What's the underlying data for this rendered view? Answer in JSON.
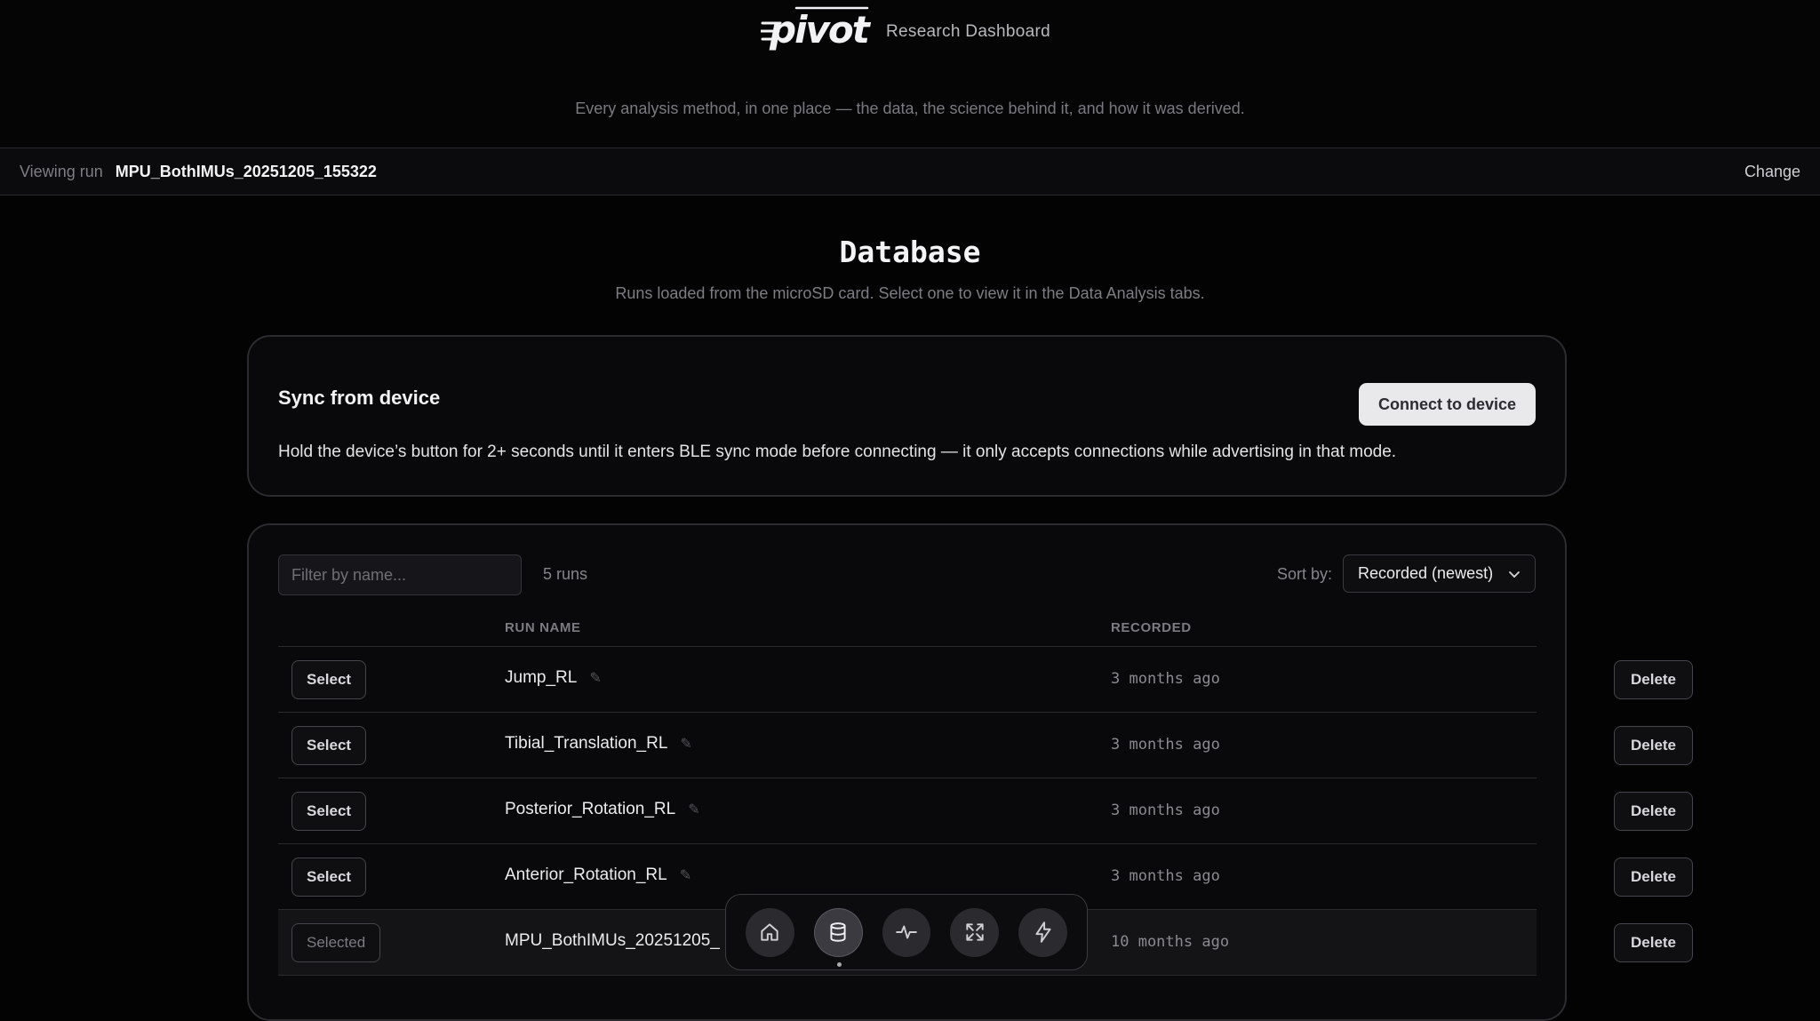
{
  "header": {
    "logo_text": "pivot",
    "subtitle": "Research Dashboard",
    "tagline": "Every analysis method, in one place — the data, the science behind it, and how it was derived."
  },
  "runbar": {
    "label": "Viewing run",
    "run_name": "MPU_BothIMUs_20251205_155322",
    "change_label": "Change"
  },
  "page": {
    "title": "Database",
    "subtitle": "Runs loaded from the microSD card. Select one to view it in the Data Analysis tabs."
  },
  "sync": {
    "title": "Sync from device",
    "hint": "Hold the device’s button for 2+ seconds until it enters BLE sync mode before connecting — it only accepts connections while advertising in that mode.",
    "connect_label": "Connect to device"
  },
  "runs": {
    "filter_placeholder": "Filter by name...",
    "count": "5 runs",
    "sort_label": "Sort by:",
    "sort_value": "Recorded (newest)",
    "columns": {
      "name": "RUN NAME",
      "recorded": "RECORDED"
    },
    "rows": [
      {
        "select": "Select",
        "name": "Jump_RL",
        "recorded": "3 months ago",
        "delete": "Delete"
      },
      {
        "select": "Select",
        "name": "Tibial_Translation_RL",
        "recorded": "3 months ago",
        "delete": "Delete"
      },
      {
        "select": "Select",
        "name": "Posterior_Rotation_RL",
        "recorded": "3 months ago",
        "delete": "Delete"
      },
      {
        "select": "Select",
        "name": "Anterior_Rotation_RL",
        "recorded": "3 months ago",
        "delete": "Delete"
      },
      {
        "select": "Selected",
        "name": "MPU_BothIMUs_20251205_",
        "recorded": "10 months ago",
        "delete": "Delete"
      }
    ]
  },
  "dock": {
    "items": [
      "home-icon",
      "database-icon",
      "activity-icon",
      "expand-icon",
      "bolt-icon"
    ],
    "active": "database-icon"
  }
}
